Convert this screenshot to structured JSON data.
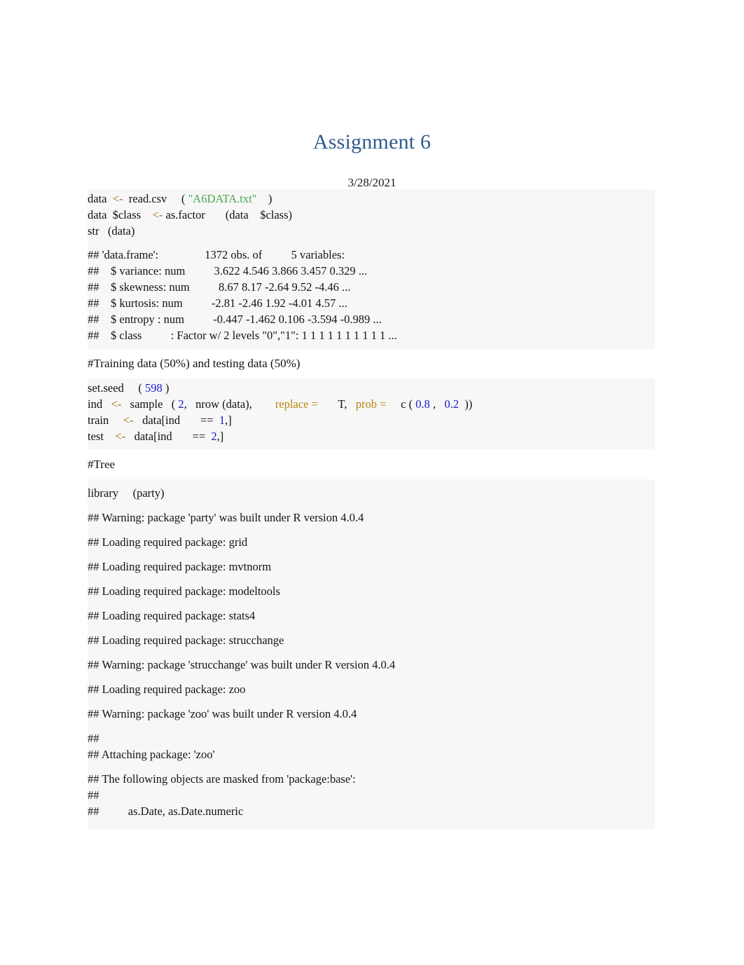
{
  "document": {
    "title": "Assignment 6",
    "date": "3/28/2021",
    "accent_title_color": "#2E5C8A",
    "code_background": "#F7F7F7",
    "page_background": "#FFFFFF"
  },
  "syntax_colors": {
    "assign_operator": "#A06B12",
    "named_argument": "#B8860B",
    "string": "#4CA64C",
    "number": "#1A1AC8",
    "plain": "#111111"
  },
  "chunk1": {
    "line1": {
      "a": "data  ",
      "op": "<-",
      "b": "  read.csv     ( ",
      "str": "\"A6DATA.txt\"",
      "c": "    )"
    },
    "line2": {
      "a": "data  $class    ",
      "op": "<-",
      "b": " as.factor       (data    $class)"
    },
    "line3": "str   (data)"
  },
  "chunk1_output": [
    "## 'data.frame':                1372 obs. of          5 variables:",
    "##    $ variance: num          3.622 4.546 3.866 3.457 0.329 ...",
    "##    $ skewness: num          8.67 8.17 -2.64 9.52 -4.46 ...",
    "##    $ kurtosis: num          -2.81 -2.46 1.92 -4.01 4.57 ...",
    "##    $ entropy : num          -0.447 -1.462 0.106 -3.594 -0.989 ...",
    "##    $ class          : Factor w/ 2 levels \"0\",\"1\": 1 1 1 1 1 1 1 1 1 1 ..."
  ],
  "comment_training": "#Training data (50%) and testing data (50%)",
  "chunk2": {
    "line1": {
      "a": "set.seed     ( ",
      "num": "598",
      "b": " )"
    },
    "line2": {
      "a": "ind   ",
      "op": "<-",
      "b": "   sample   ( ",
      "num1": "2",
      "c": ",   nrow (data),        ",
      "arg1": "replace =",
      "d": "       T,   ",
      "arg2": "prob =",
      "e": "     c ( ",
      "num2": "0.8",
      "f": " ,   ",
      "num3": "0.2",
      "g": "  ))"
    },
    "line3": {
      "a": "train     ",
      "op": "<-",
      "b": "   data[ind       ==  ",
      "num": "1",
      "c": ",]"
    },
    "line4": {
      "a": "test    ",
      "op": "<-",
      "b": "   data[ind       ==  ",
      "num": "2",
      "c": ",]"
    }
  },
  "comment_tree": "#Tree",
  "chunk3": {
    "line1": "library     (party)"
  },
  "messages": [
    "## Warning: package 'party' was built under R version 4.0.4",
    "## Loading required package: grid",
    "## Loading required package: mvtnorm",
    "## Loading required package: modeltools",
    "## Loading required package: stats4",
    "## Loading required package: strucchange",
    "## Warning: package 'strucchange' was built under R version 4.0.4",
    "## Loading required package: zoo",
    "## Warning: package 'zoo' was built under R version 4.0.4"
  ],
  "attach_block": [
    "##",
    "## Attaching package: 'zoo'"
  ],
  "masked_block": [
    "## The following objects are masked from 'package:base':",
    "##",
    "##          as.Date, as.Date.numeric"
  ]
}
